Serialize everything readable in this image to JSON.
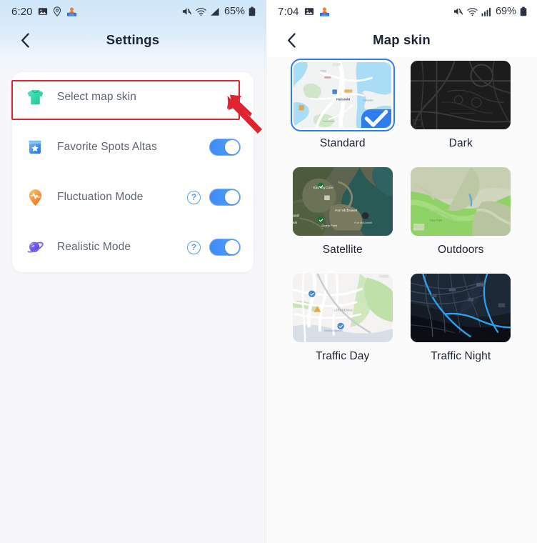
{
  "left": {
    "status_bar": {
      "time": "6:20",
      "battery_percent": "65%",
      "icons": [
        "image-icon",
        "location-pin-icon",
        "map-person-icon",
        "mute-icon",
        "wifi-icon",
        "signal-icon",
        "battery-icon"
      ]
    },
    "nav": {
      "back_label": "‹",
      "title": "Settings"
    },
    "settings_rows": [
      {
        "id": "select-map-skin",
        "label": "Select map skin",
        "icon": "tshirt-icon",
        "control": "chevron",
        "chevron": "›",
        "highlighted": true
      },
      {
        "id": "favorite-spots-altas",
        "label": "Favorite Spots Altas",
        "icon": "ticket-star-icon",
        "control": "toggle",
        "toggle_on": true,
        "help": false
      },
      {
        "id": "fluctuation-mode",
        "label": "Fluctuation Mode",
        "icon": "pin-pulse-icon",
        "control": "toggle",
        "toggle_on": true,
        "help": true,
        "help_label": "?"
      },
      {
        "id": "realistic-mode",
        "label": "Realistic Mode",
        "icon": "planet-icon",
        "control": "toggle",
        "toggle_on": true,
        "help": true,
        "help_label": "?"
      }
    ],
    "annotation": {
      "highlight_color": "#e0242e",
      "arrow_color": "#e0242e",
      "points_at": "select-map-skin"
    }
  },
  "right": {
    "status_bar": {
      "time": "7:04",
      "battery_percent": "69%",
      "icons": [
        "image-icon",
        "map-person-icon",
        "mute-icon",
        "wifi-icon",
        "signal-icon",
        "battery-icon"
      ]
    },
    "nav": {
      "back_label": "‹",
      "title": "Map skin"
    },
    "skins": [
      {
        "id": "standard",
        "label": "Standard",
        "style": "standard",
        "selected": true
      },
      {
        "id": "dark",
        "label": "Dark",
        "style": "dark",
        "selected": false
      },
      {
        "id": "satellite",
        "label": "Satellite",
        "style": "satellite",
        "selected": false
      },
      {
        "id": "outdoors",
        "label": "Outdoors",
        "style": "outdoors",
        "selected": false
      },
      {
        "id": "traffic-day",
        "label": "Traffic Day",
        "style": "trafficday",
        "selected": false
      },
      {
        "id": "traffic-night",
        "label": "Traffic Night",
        "style": "trafficnight",
        "selected": false
      }
    ],
    "selected_badge_icon": "check-icon"
  },
  "colors": {
    "accent_blue": "#2f7ded",
    "toggle_on": "#3d8bf5",
    "annotation_red": "#e0242e",
    "title_text": "#1d2633",
    "row_text": "#5d6470"
  }
}
